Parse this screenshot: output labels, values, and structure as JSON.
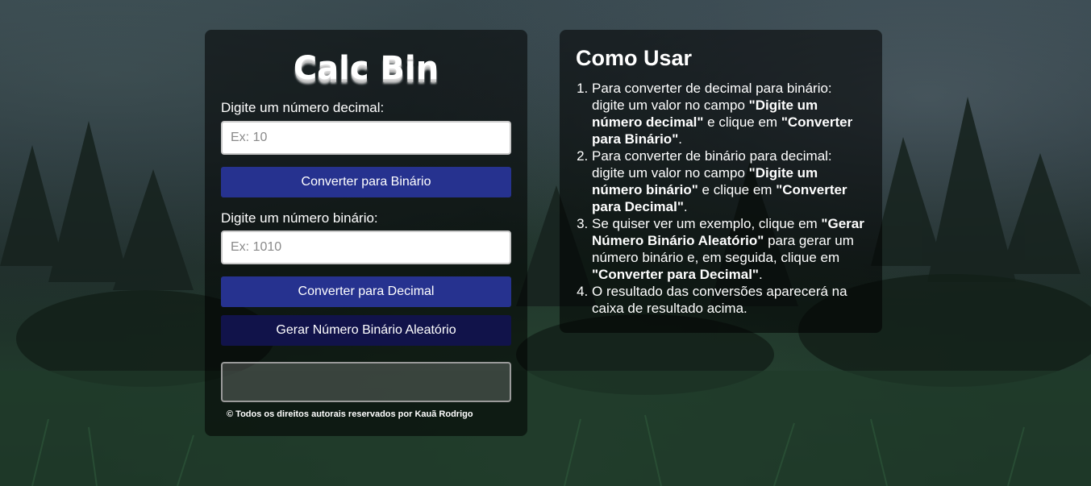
{
  "app": {
    "title": "Calc Bin"
  },
  "decimal_input": {
    "label": "Digite um número decimal:",
    "placeholder": "Ex: 10",
    "value": ""
  },
  "to_binary_button": {
    "label": "Converter para Binário"
  },
  "binary_input": {
    "label": "Digite um número binário:",
    "placeholder": "Ex: 1010",
    "value": ""
  },
  "to_decimal_button": {
    "label": "Converter para Decimal"
  },
  "random_button": {
    "label": "Gerar Número Binário Aleatório"
  },
  "result": {
    "value": ""
  },
  "footer": {
    "text": "© Todos os direitos autorais reservados por Kauã Rodrigo"
  },
  "help": {
    "title": "Como Usar",
    "steps": [
      {
        "part1": "Para converter de decimal para binário: digite um valor no campo ",
        "bold1": "\"Digite um número decimal\"",
        "part2": " e clique em ",
        "bold2": "\"Converter para Binário\"",
        "part3": "."
      },
      {
        "part1": "Para converter de binário para decimal: digite um valor no campo ",
        "bold1": "\"Digite um número binário\"",
        "part2": " e clique em ",
        "bold2": "\"Converter para Decimal\"",
        "part3": "."
      },
      {
        "part1": "Se quiser ver um exemplo, clique em ",
        "bold1": "\"Gerar Número Binário Aleatório\"",
        "part2": " para gerar um número binário e, em seguida, clique em ",
        "bold2": "\"Converter para Decimal\"",
        "part3": "."
      },
      {
        "part1": "O resultado das conversões aparecerá na caixa de resultado acima."
      }
    ]
  },
  "colors": {
    "primary_button": "#26328f",
    "dark_button": "#11134a",
    "card_background": "rgba(0,0,0,0.55)"
  }
}
